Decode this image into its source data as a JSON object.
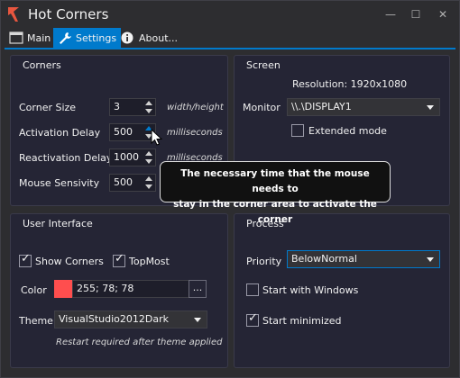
{
  "window": {
    "title": "Hot Corners",
    "minimize_glyph": "—",
    "maximize_glyph": "☐",
    "close_glyph": "✕"
  },
  "tabs": [
    {
      "label": "Main",
      "icon": "window-icon"
    },
    {
      "label": "Settings",
      "icon": "wrench-icon"
    },
    {
      "label": "About...",
      "icon": "info-icon"
    }
  ],
  "corners": {
    "title": "Corners",
    "corner_size_label": "Corner Size",
    "corner_size_value": "3",
    "corner_size_unit": "width/height",
    "activation_label": "Activation Delay",
    "activation_value": "500",
    "activation_unit": "milliseconds",
    "reactivation_label": "Reactivation Delay",
    "reactivation_value": "1000",
    "reactivation_unit": "milliseconds",
    "sensivity_label": "Mouse Sensivity",
    "sensivity_value": "500"
  },
  "tooltip": {
    "line1": "The necessary time that the mouse needs to",
    "line2": "stay in the corner area to activate the corner"
  },
  "screen": {
    "title": "Screen",
    "resolution_text": "Resolution: 1920x1080",
    "monitor_label": "Monitor",
    "monitor_value": "\\\\.\\DISPLAY1",
    "extended_label": "Extended mode",
    "extended_checked": false
  },
  "ui": {
    "title": "User Interface",
    "show_corners_label": "Show Corners",
    "show_corners_checked": true,
    "topmost_label": "TopMost",
    "topmost_checked": true,
    "color_label": "Color",
    "color_value": "255; 78; 78",
    "color_hex": "#ff4e4e",
    "color_button": "...",
    "theme_label": "Theme",
    "theme_value": "VisualStudio2012Dark",
    "theme_note": "Restart required after theme applied"
  },
  "process": {
    "title": "Process",
    "priority_label": "Priority",
    "priority_value": "BelowNormal",
    "start_windows_label": "Start with Windows",
    "start_windows_checked": false,
    "start_min_label": "Start minimized",
    "start_min_checked": true
  },
  "colors": {
    "accent": "#007acc",
    "background": "#2d2d30",
    "panel": "#252535"
  }
}
